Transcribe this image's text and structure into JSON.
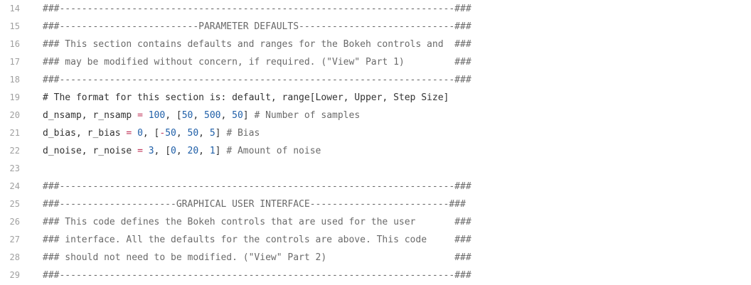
{
  "editor": {
    "lines": [
      {
        "number": "14",
        "tokens": [
          {
            "t": "comment",
            "v": "###-----------------------------------------------------------------------###"
          }
        ]
      },
      {
        "number": "15",
        "tokens": [
          {
            "t": "comment",
            "v": "###-------------------------PARAMETER DEFAULTS----------------------------###"
          }
        ]
      },
      {
        "number": "16",
        "tokens": [
          {
            "t": "comment",
            "v": "### This section contains defaults and ranges for the Bokeh controls and  ###"
          }
        ]
      },
      {
        "number": "17",
        "tokens": [
          {
            "t": "comment",
            "v": "### may be modified without concern, if required. (\"View\" Part 1)         ###"
          }
        ]
      },
      {
        "number": "18",
        "tokens": [
          {
            "t": "comment",
            "v": "###-----------------------------------------------------------------------###"
          }
        ]
      },
      {
        "number": "19",
        "tokens": [
          {
            "t": "plain",
            "v": "# The format for this section is: default, range[Lower, Upper, Step Size]"
          }
        ]
      },
      {
        "number": "20",
        "tokens": [
          {
            "t": "plain",
            "v": "d_nsamp, r_nsamp "
          },
          {
            "t": "op",
            "v": "="
          },
          {
            "t": "plain",
            "v": " "
          },
          {
            "t": "num",
            "v": "100"
          },
          {
            "t": "plain",
            "v": ", ["
          },
          {
            "t": "num",
            "v": "50"
          },
          {
            "t": "plain",
            "v": ", "
          },
          {
            "t": "num",
            "v": "500"
          },
          {
            "t": "plain",
            "v": ", "
          },
          {
            "t": "num",
            "v": "50"
          },
          {
            "t": "plain",
            "v": "] "
          },
          {
            "t": "comment",
            "v": "# Number of samples"
          }
        ]
      },
      {
        "number": "21",
        "tokens": [
          {
            "t": "plain",
            "v": "d_bias, r_bias "
          },
          {
            "t": "op",
            "v": "="
          },
          {
            "t": "plain",
            "v": " "
          },
          {
            "t": "num",
            "v": "0"
          },
          {
            "t": "plain",
            "v": ", ["
          },
          {
            "t": "op",
            "v": "-"
          },
          {
            "t": "num",
            "v": "50"
          },
          {
            "t": "plain",
            "v": ", "
          },
          {
            "t": "num",
            "v": "50"
          },
          {
            "t": "plain",
            "v": ", "
          },
          {
            "t": "num",
            "v": "5"
          },
          {
            "t": "plain",
            "v": "] "
          },
          {
            "t": "comment",
            "v": "# Bias"
          }
        ]
      },
      {
        "number": "22",
        "tokens": [
          {
            "t": "plain",
            "v": "d_noise, r_noise "
          },
          {
            "t": "op",
            "v": "="
          },
          {
            "t": "plain",
            "v": " "
          },
          {
            "t": "num",
            "v": "3"
          },
          {
            "t": "plain",
            "v": ", ["
          },
          {
            "t": "num",
            "v": "0"
          },
          {
            "t": "plain",
            "v": ", "
          },
          {
            "t": "num",
            "v": "20"
          },
          {
            "t": "plain",
            "v": ", "
          },
          {
            "t": "num",
            "v": "1"
          },
          {
            "t": "plain",
            "v": "] "
          },
          {
            "t": "comment",
            "v": "# Amount of noise"
          }
        ]
      },
      {
        "number": "23",
        "tokens": []
      },
      {
        "number": "24",
        "tokens": [
          {
            "t": "comment",
            "v": "###-----------------------------------------------------------------------###"
          }
        ]
      },
      {
        "number": "25",
        "tokens": [
          {
            "t": "comment",
            "v": "###---------------------GRAPHICAL USER INTERFACE-------------------------###"
          }
        ]
      },
      {
        "number": "26",
        "tokens": [
          {
            "t": "comment",
            "v": "### This code defines the Bokeh controls that are used for the user       ###"
          }
        ]
      },
      {
        "number": "27",
        "tokens": [
          {
            "t": "comment",
            "v": "### interface. All the defaults for the controls are above. This code     ###"
          }
        ]
      },
      {
        "number": "28",
        "tokens": [
          {
            "t": "comment",
            "v": "### should not need to be modified. (\"View\" Part 2)                       ###"
          }
        ]
      },
      {
        "number": "29",
        "tokens": [
          {
            "t": "comment",
            "v": "###-----------------------------------------------------------------------###"
          }
        ]
      }
    ]
  }
}
